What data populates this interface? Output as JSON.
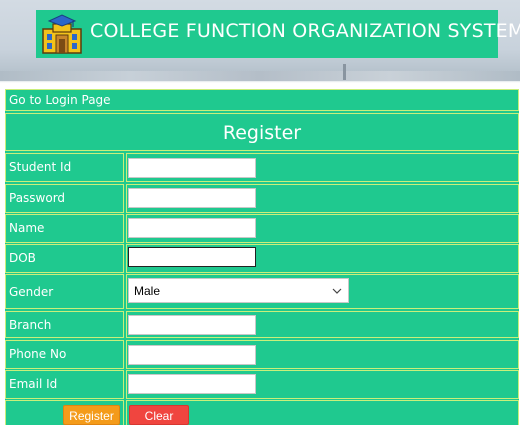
{
  "header": {
    "title": "COLLEGE FUNCTION ORGANIZATION SYSTEM",
    "logo_icon": "college-building-icon",
    "accent": "#1fc98f"
  },
  "nav": {
    "login_link": "Go to Login Page"
  },
  "form": {
    "heading": "Register",
    "fields": [
      {
        "label": "Student Id",
        "value": ""
      },
      {
        "label": "Password",
        "value": ""
      },
      {
        "label": "Name",
        "value": ""
      },
      {
        "label": "DOB",
        "value": ""
      },
      {
        "label": "Gender",
        "value": "Male"
      },
      {
        "label": "Branch",
        "value": ""
      },
      {
        "label": "Phone No",
        "value": ""
      },
      {
        "label": "Email Id",
        "value": ""
      }
    ],
    "register_label": "Register",
    "clear_label": "Clear",
    "register_color": "#f49b1a",
    "clear_color": "#f0453f"
  }
}
